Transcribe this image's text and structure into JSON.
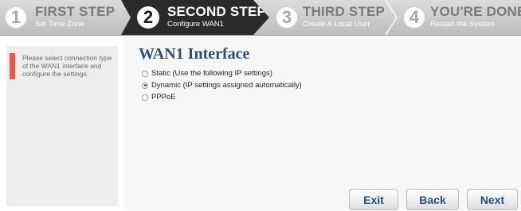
{
  "steps": [
    {
      "number": "1",
      "title": "FIRST STEP",
      "subtitle": "Set Time Zone"
    },
    {
      "number": "2",
      "title": "SECOND STEP",
      "subtitle": "Configure WAN1"
    },
    {
      "number": "3",
      "title": "THIRD STEP",
      "subtitle": "Create A Local User"
    },
    {
      "number": "4",
      "title": "YOU'RE DONE",
      "subtitle": "Restart the System"
    }
  ],
  "active_step": 2,
  "sidebar": {
    "message": "Please select connection type of the WAN1 interface and configure the settings."
  },
  "main": {
    "heading": "WAN1 Interface",
    "options": [
      {
        "label": "Static (Use the following IP settings)",
        "selected": false
      },
      {
        "label": "Dynamic (IP settings assigned automatically)",
        "selected": true
      },
      {
        "label": "PPPoE",
        "selected": false
      }
    ]
  },
  "buttons": {
    "exit": "Exit",
    "back": "Back",
    "next": "Next"
  },
  "colors": {
    "active_step_bg": "#2a2a2a",
    "accent_bar": "#e8584c",
    "heading": "#2f4f6f"
  }
}
